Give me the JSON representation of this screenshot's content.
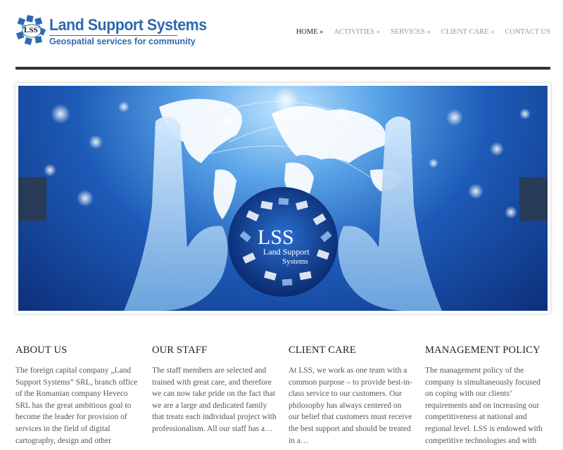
{
  "header": {
    "logo_badge": "LSS",
    "logo_title": "Land Support Systems",
    "logo_subtitle": "Geospatial services for community"
  },
  "nav": {
    "items": [
      {
        "label": "HOME »",
        "active": true
      },
      {
        "label": "ACTIVITIES »",
        "active": false
      },
      {
        "label": "SERVICES »",
        "active": false
      },
      {
        "label": "CLIENT CARE »",
        "active": false
      },
      {
        "label": "CONTACT US",
        "active": false
      }
    ]
  },
  "slider": {
    "emblem_text": "LSS",
    "emblem_line1": "Land Support",
    "emblem_line2": "Systems"
  },
  "sections": [
    {
      "title": "ABOUT US",
      "text": "The foreign capital company „Land Support Systems” SRL, branch office of the Romanian company Heveco SRL  has the great ambitious goal to become the leader for provision of services in the field of digital cartography, design and other"
    },
    {
      "title": "OUR STAFF",
      "text": "The staff members are selected and trained with great care, and therefore we can now take pride on the fact that we are a large and dedicated family that treats each individual project with professionalism. All our staff has a…"
    },
    {
      "title": "CLIENT CARE",
      "text": "At LSS, we work as one team with a common purpose – to provide best-in-class service to our customers. Our philosophy has always centered on our belief that customers must receive the best support and should be treated in a…"
    },
    {
      "title": "MANAGEMENT POLICY",
      "text": "The management policy of the company is simultaneously focused on coping with our clients’ requirements and on increasing our competitiveness at national and regional level. LSS is endowed with competitive technologies and with"
    }
  ],
  "colors": {
    "brand": "#2d6ab0",
    "rule": "#333333",
    "nav_inactive": "#999999"
  }
}
